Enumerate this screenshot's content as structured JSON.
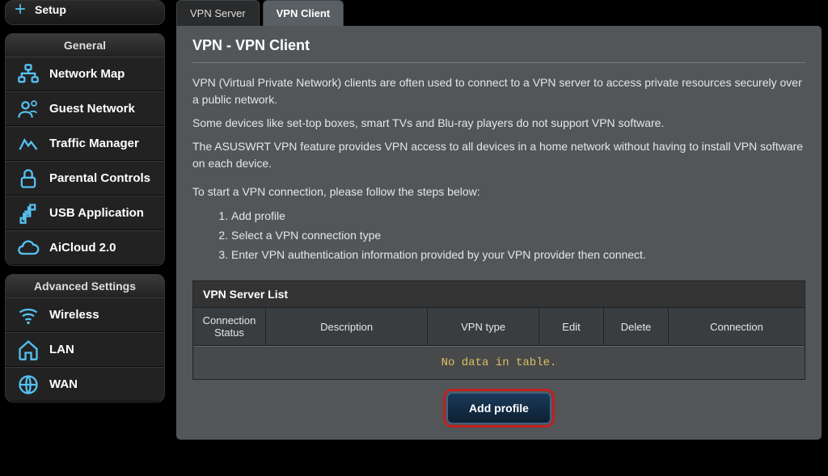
{
  "sidebar": {
    "top": {
      "label": "Setup"
    },
    "general": {
      "title": "General",
      "items": [
        {
          "label": "Network Map",
          "icon": "network-map"
        },
        {
          "label": "Guest Network",
          "icon": "guest"
        },
        {
          "label": "Traffic Manager",
          "icon": "traffic"
        },
        {
          "label": "Parental Controls",
          "icon": "lock"
        },
        {
          "label": "USB Application",
          "icon": "usb"
        },
        {
          "label": "AiCloud 2.0",
          "icon": "cloud"
        }
      ]
    },
    "advanced": {
      "title": "Advanced Settings",
      "items": [
        {
          "label": "Wireless",
          "icon": "wifi"
        },
        {
          "label": "LAN",
          "icon": "home"
        },
        {
          "label": "WAN",
          "icon": "globe"
        }
      ]
    }
  },
  "tabs": [
    {
      "label": "VPN Server",
      "active": false
    },
    {
      "label": "VPN Client",
      "active": true
    }
  ],
  "page": {
    "title": "VPN - VPN Client",
    "desc1": "VPN (Virtual Private Network) clients are often used to connect to a VPN server to access private resources securely over a public network.",
    "desc2": "Some devices like set-top boxes, smart TVs and Blu-ray players do not support VPN software.",
    "desc3": "The ASUSWRT VPN feature provides VPN access to all devices in a home network without having to install VPN software on each device.",
    "steps_intro": "To start a VPN connection, please follow the steps below:",
    "steps": [
      "Add profile",
      "Select a VPN connection type",
      "Enter VPN authentication information provided by your VPN provider then connect."
    ]
  },
  "table": {
    "title": "VPN Server List",
    "headers": {
      "status": "Connection Status",
      "desc": "Description",
      "type": "VPN type",
      "edit": "Edit",
      "delete": "Delete",
      "conn": "Connection"
    },
    "empty": "No data in table."
  },
  "buttons": {
    "add_profile": "Add profile"
  }
}
